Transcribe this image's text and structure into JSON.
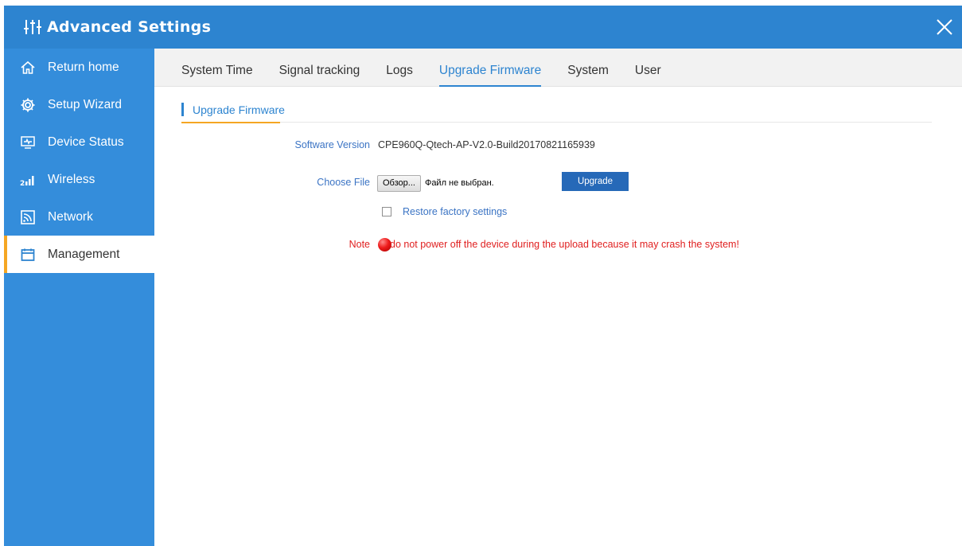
{
  "app": {
    "title": "Advanced Settings"
  },
  "sidebar": {
    "items": [
      {
        "label": "Return home",
        "icon": "home-icon"
      },
      {
        "label": "Setup Wizard",
        "icon": "gear-icon"
      },
      {
        "label": "Device Status",
        "icon": "monitor-icon"
      },
      {
        "label": "Wireless",
        "icon": "signal-icon"
      },
      {
        "label": "Network",
        "icon": "network-icon"
      },
      {
        "label": "Management",
        "icon": "clipboard-icon",
        "active": true
      }
    ]
  },
  "tabs": [
    {
      "label": "System Time"
    },
    {
      "label": "Signal tracking"
    },
    {
      "label": "Logs"
    },
    {
      "label": "Upgrade Firmware",
      "active": true
    },
    {
      "label": "System"
    },
    {
      "label": "User"
    }
  ],
  "section": {
    "title": "Upgrade Firmware"
  },
  "form": {
    "software_version_label": "Software Version",
    "software_version_value": "CPE960Q-Qtech-AP-V2.0-Build20170821165939",
    "choose_file_label": "Choose File",
    "browse_button": "Обзор...",
    "file_status": "Файл не выбран.",
    "upgrade_button": "Upgrade",
    "restore_label": "Restore factory settings",
    "restore_checked": false,
    "note_label": "Note",
    "note_text": "do not power off the device during the upload because it may crash the system!"
  },
  "colors": {
    "header": "#2d84d0",
    "sidebar": "#348ddb",
    "accent": "#f5a623",
    "link": "#3b74c4",
    "warning": "#e02020"
  }
}
